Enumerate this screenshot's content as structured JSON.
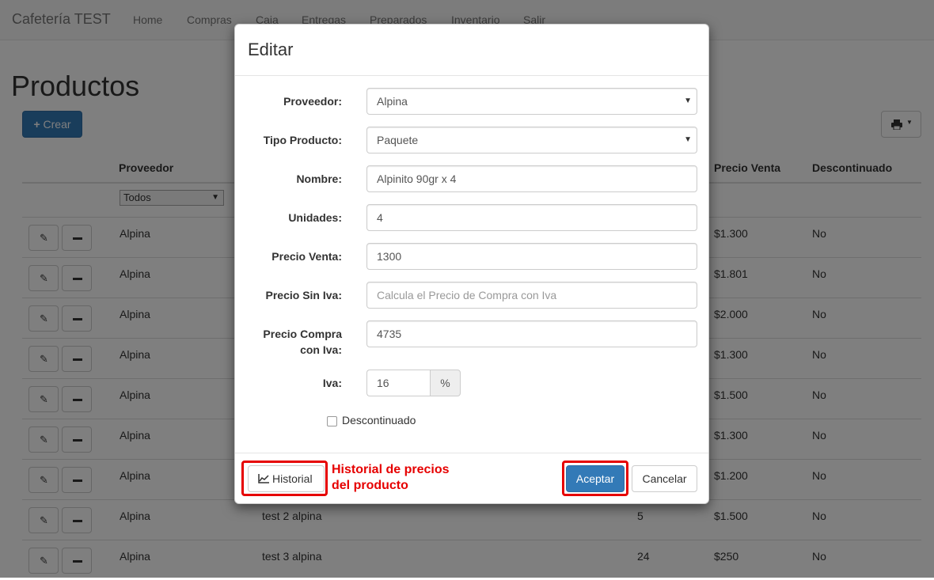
{
  "navbar": {
    "brand": "Cafetería TEST",
    "items": [
      "Home",
      "Compras",
      "Caja",
      "Entregas",
      "Preparados",
      "Inventario",
      "Salir"
    ]
  },
  "page": {
    "title": "Productos",
    "create_label": "Crear"
  },
  "table": {
    "headers": {
      "proveedor": "Proveedor",
      "precio_venta": "Precio Venta",
      "descontinuado": "Descontinuado"
    },
    "filter_value": "Todos",
    "rows": [
      {
        "proveedor": "Alpina",
        "nombre": "",
        "unidades": "",
        "precio_venta": "$1.300",
        "descontinuado": "No"
      },
      {
        "proveedor": "Alpina",
        "nombre": "",
        "unidades": "",
        "precio_venta": "$1.801",
        "descontinuado": "No"
      },
      {
        "proveedor": "Alpina",
        "nombre": "",
        "unidades": "",
        "precio_venta": "$2.000",
        "descontinuado": "No"
      },
      {
        "proveedor": "Alpina",
        "nombre": "",
        "unidades": "",
        "precio_venta": "$1.300",
        "descontinuado": "No"
      },
      {
        "proveedor": "Alpina",
        "nombre": "",
        "unidades": "",
        "precio_venta": "$1.500",
        "descontinuado": "No"
      },
      {
        "proveedor": "Alpina",
        "nombre": "",
        "unidades": "",
        "precio_venta": "$1.300",
        "descontinuado": "No"
      },
      {
        "proveedor": "Alpina",
        "nombre": "",
        "unidades": "",
        "precio_venta": "$1.200",
        "descontinuado": "No"
      },
      {
        "proveedor": "Alpina",
        "nombre": "test 2 alpina",
        "unidades": "5",
        "precio_venta": "$1.500",
        "descontinuado": "No"
      },
      {
        "proveedor": "Alpina",
        "nombre": "test 3 alpina",
        "unidades": "24",
        "precio_venta": "$250",
        "descontinuado": "No"
      }
    ]
  },
  "modal": {
    "title": "Editar",
    "fields": {
      "proveedor": {
        "label": "Proveedor:",
        "value": "Alpina"
      },
      "tipo_producto": {
        "label": "Tipo Producto:",
        "value": "Paquete"
      },
      "nombre": {
        "label": "Nombre:",
        "value": "Alpinito 90gr x 4"
      },
      "unidades": {
        "label": "Unidades:",
        "value": "4"
      },
      "precio_venta": {
        "label": "Precio Venta:",
        "value": "1300"
      },
      "precio_sin_iva": {
        "label": "Precio Sin Iva:",
        "value": "",
        "placeholder": "Calcula el Precio de Compra con Iva"
      },
      "precio_compra": {
        "label_line1": "Precio Compra",
        "label_line2": "con Iva:",
        "value": "4735"
      },
      "iva": {
        "label": "Iva:",
        "value": "16",
        "addon": "%"
      }
    },
    "checkbox_label": "Descontinuado",
    "historial_label": "Historial",
    "accept_label": "Aceptar",
    "cancel_label": "Cancelar"
  },
  "annotation": {
    "line1": "Historial de precios",
    "line2": "del producto",
    "color": "#e60000"
  },
  "colors": {
    "primary": "#337ab7",
    "navbar_bg": "#f8f8f8",
    "annotation": "#e60000"
  }
}
